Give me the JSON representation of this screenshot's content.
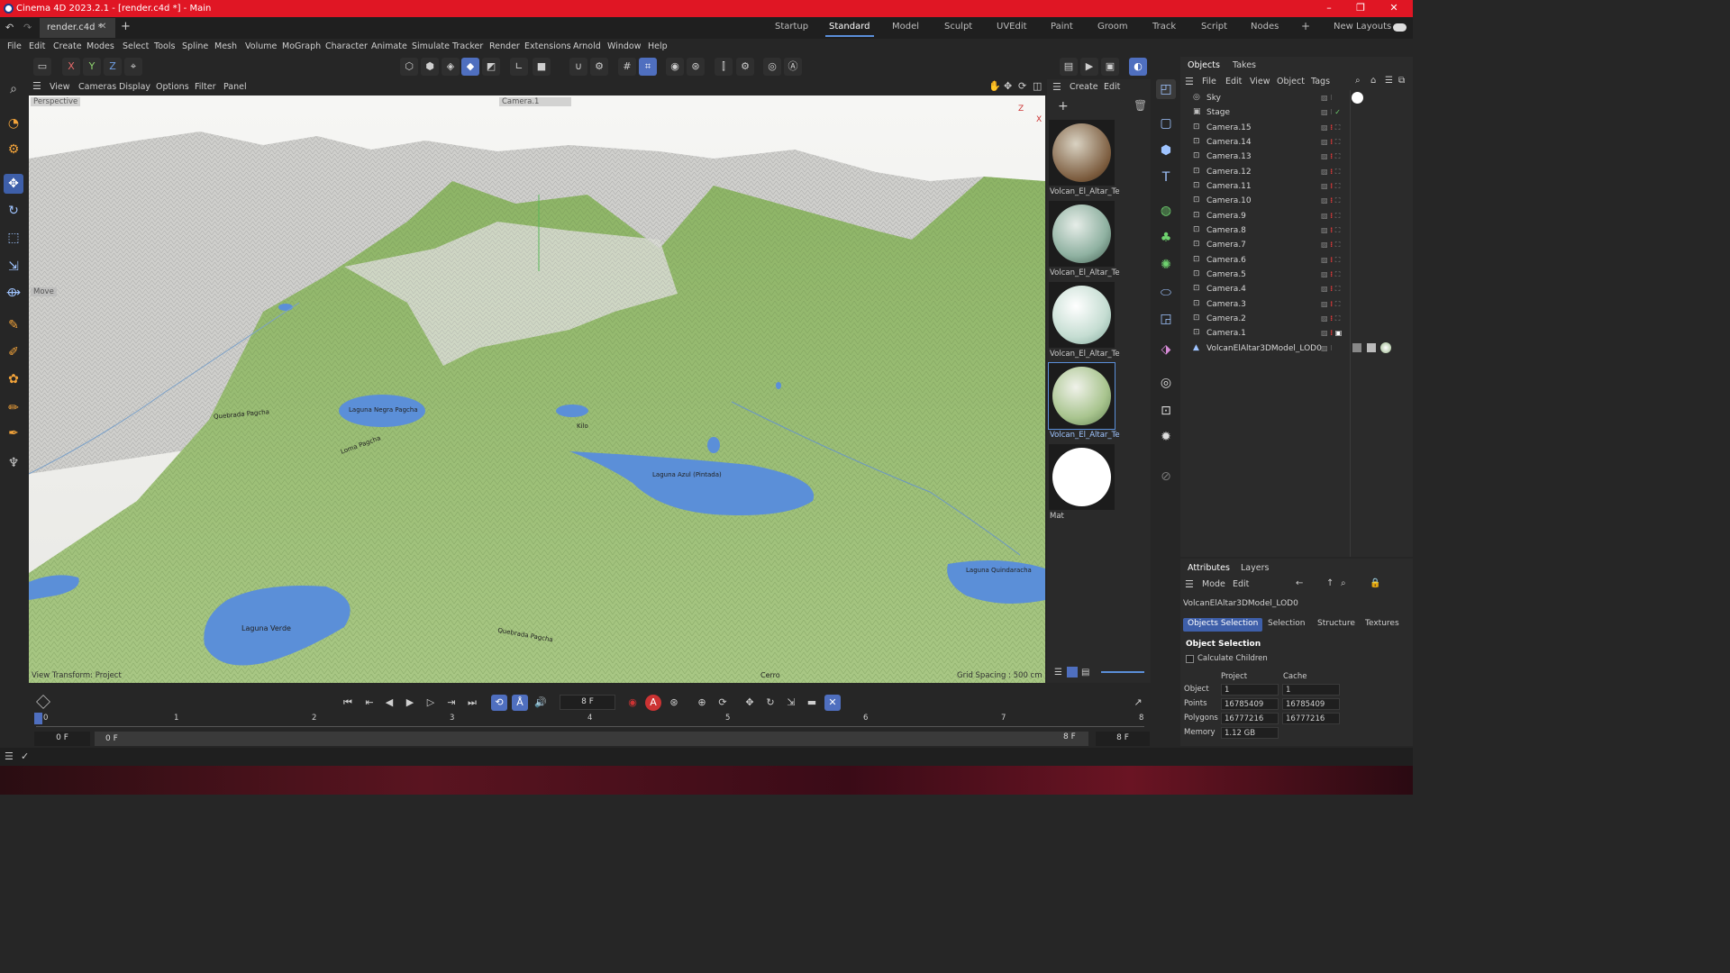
{
  "window": {
    "title": "Cinema 4D 2023.2.1 - [render.c4d *] - Main",
    "controls": [
      "–",
      "❐",
      "✕"
    ]
  },
  "tabs": {
    "file_tab": "render.c4d *",
    "new_tab": "+"
  },
  "layouts": {
    "items": [
      "Startup",
      "Standard",
      "Model",
      "Sculpt",
      "UVEdit",
      "Paint",
      "Groom",
      "Track",
      "Script",
      "Nodes"
    ],
    "active": "Standard",
    "add": "+",
    "new_layouts": "New Layouts"
  },
  "menubar": [
    "File",
    "Edit",
    "Create",
    "Modes",
    "Select",
    "Tools",
    "Spline",
    "Mesh",
    "Volume",
    "MoGraph",
    "Character",
    "Animate",
    "Simulate",
    "Tracker",
    "Render",
    "Extensions",
    "Arnold",
    "Window",
    "Help"
  ],
  "toolbar": {
    "axes": [
      "X",
      "Y",
      "Z"
    ]
  },
  "viewport_menu": [
    "View",
    "Cameras",
    "Display",
    "Options",
    "Filter",
    "Panel"
  ],
  "viewport": {
    "projection": "Perspective",
    "camera": "Camera.1",
    "mode": "Move",
    "status_left": "View Transform: Project",
    "status_right": "Grid Spacing : 500 cm",
    "axis_z": "Z",
    "axis_x": "X",
    "map_labels": {
      "laguna_negra": "Laguna Negra Pagcha",
      "laguna_azul": "Laguna Azul (Pintada)",
      "laguna_verde": "Laguna Verde",
      "laguna_quadra": "Laguna Quindaracha",
      "cerro": "Cerro",
      "kilo": "Kilo",
      "road1": "Quebrada Pagcha",
      "road2": "Quebrada Pagcha",
      "road3": "Loma Pagcha"
    }
  },
  "material_panel": {
    "menu": [
      "Create",
      "Edit"
    ],
    "materials": [
      {
        "name": "Volcan_El_Altar_Te",
        "color": "#7a5a3c"
      },
      {
        "name": "Volcan_El_Altar_Te",
        "color": "#8fb1a1"
      },
      {
        "name": "Volcan_El_Altar_Te",
        "color": "#c5ddd2"
      },
      {
        "name": "Volcan_El_Altar_Te",
        "color": "#a8c48e"
      },
      {
        "name": "Mat",
        "color": "#ffffff"
      }
    ]
  },
  "object_manager": {
    "tabs": [
      "Objects",
      "Takes"
    ],
    "active_tab": "Objects",
    "menu": [
      "File",
      "Edit",
      "View",
      "Object",
      "Tags"
    ],
    "objects": [
      "Sky",
      "Stage",
      "Camera.15",
      "Camera.14",
      "Camera.13",
      "Camera.12",
      "Camera.11",
      "Camera.10",
      "Camera.9",
      "Camera.8",
      "Camera.7",
      "Camera.6",
      "Camera.5",
      "Camera.4",
      "Camera.3",
      "Camera.2",
      "Camera.1",
      "VolcanElAltar3DModel_LOD0"
    ]
  },
  "attributes": {
    "tabs": [
      "Attributes",
      "Layers"
    ],
    "active_tab": "Attributes",
    "menu": [
      "Mode",
      "Edit"
    ],
    "object_name": "VolcanElAltar3DModel_LOD0",
    "sub_tabs": [
      "Objects Selection",
      "Selection",
      "Structure",
      "Textures"
    ],
    "active_sub_tab": "Objects Selection",
    "section": "Object Selection",
    "calc_children": "Calculate Children",
    "columns": [
      "Project",
      "Cache"
    ],
    "rows": [
      {
        "label": "Object",
        "project": "1",
        "cache": "1"
      },
      {
        "label": "Points",
        "project": "16785409",
        "cache": "16785409"
      },
      {
        "label": "Polygons",
        "project": "16777216",
        "cache": "16777216"
      },
      {
        "label": "Memory",
        "project": "1.12 GB",
        "cache": ""
      }
    ]
  },
  "timeline": {
    "current_frame": "8 F",
    "ticks": [
      "0",
      "1",
      "2",
      "3",
      "4",
      "5",
      "6",
      "7",
      "8"
    ],
    "start": "0 F",
    "range_start": "0 F",
    "range_end": "8 F",
    "end": "8 F"
  }
}
